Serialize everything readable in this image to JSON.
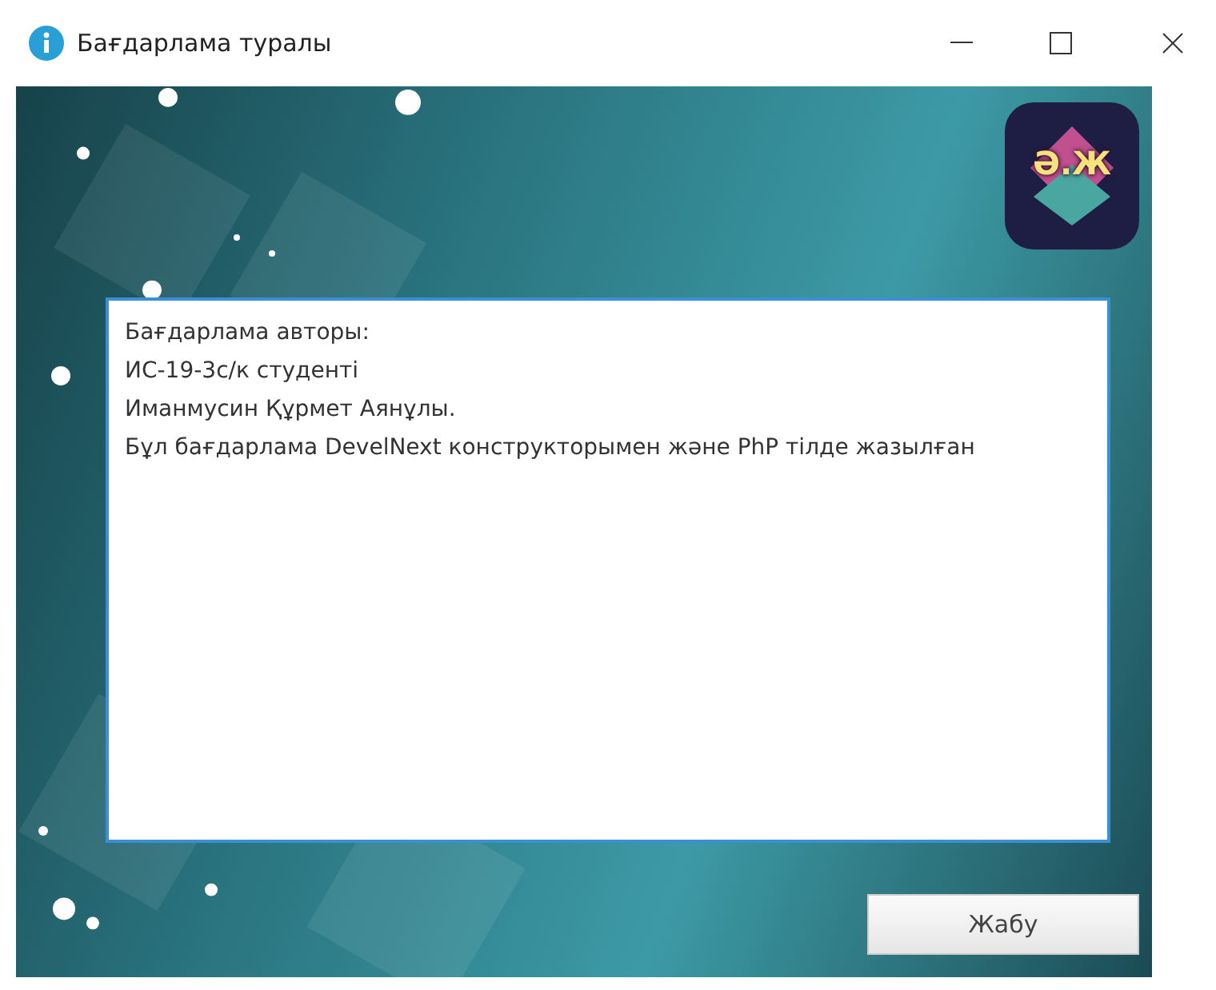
{
  "window": {
    "title": "Бағдарлама туралы"
  },
  "logo": {
    "text": "Ә.Ж"
  },
  "text_area": {
    "lines": [
      "Бағдарлама авторы:",
      "ИС-19-3с/к студенті",
      "Иманмусин Құрмет Аянұлы.",
      "Бұл бағдарлама DevelNext конструкторымен және PhP тілде жазылған"
    ]
  },
  "buttons": [
    {
      "label": "Жабу"
    }
  ]
}
